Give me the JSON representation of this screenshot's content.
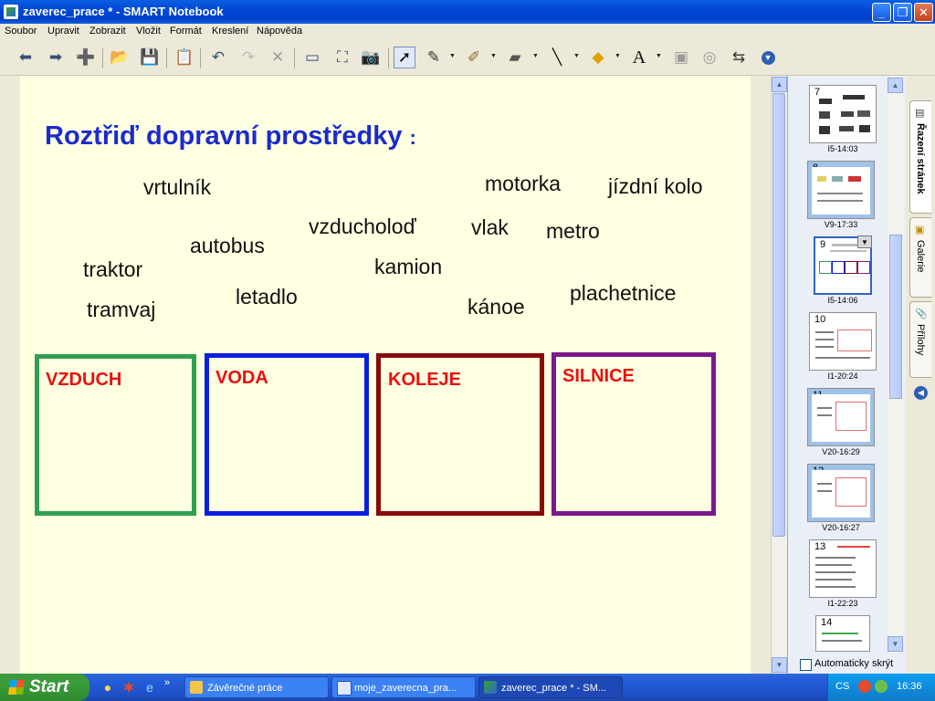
{
  "window": {
    "title": "zaverec_prace * - SMART Notebook"
  },
  "menu": [
    "Soubor",
    "Upravit",
    "Zobrazit",
    "Vložit",
    "Formát",
    "Kreslení",
    "Nápověda"
  ],
  "page": {
    "title": "Roztřiď  dopravní  prostředky",
    "title_colon": ":",
    "words": [
      "vrtulník",
      "motorka",
      "jízdní kolo",
      "vzducholoď",
      "vlak",
      "metro",
      "autobus",
      "traktor",
      "kamion",
      "letadlo",
      "plachetnice",
      "tramvaj",
      "kánoe"
    ],
    "categories": [
      {
        "label": "VZDUCH",
        "color": "#2fa04f"
      },
      {
        "label": "VODA",
        "color": "#0a1ee0"
      },
      {
        "label": "KOLEJE",
        "color": "#8a0a0a"
      },
      {
        "label": "SILNICE",
        "color": "#7a1a8a"
      }
    ]
  },
  "sorter": {
    "pages": [
      {
        "num": "7",
        "caption": "I5-14:03"
      },
      {
        "num": "8",
        "caption": "V9-17:33"
      },
      {
        "num": "9",
        "caption": "I5-14:06"
      },
      {
        "num": "10",
        "caption": "I1-20:24"
      },
      {
        "num": "11",
        "caption": "V20-16:29"
      },
      {
        "num": "12",
        "caption": "V20-16:27"
      },
      {
        "num": "13",
        "caption": "I1-22:23"
      },
      {
        "num": "14",
        "caption": ""
      }
    ],
    "auto_hide": "Automaticky skrýt"
  },
  "tabs": [
    "Řazení stránek",
    "Galerie",
    "Přílohy"
  ],
  "taskbar": {
    "start": "Start",
    "quicklaunch_more": "»",
    "tasks": [
      "Závěrečné práce",
      "moje_zaverecna_pra...",
      "zaverec_prace * - SM..."
    ],
    "lang": "CS",
    "clock": "16:36"
  }
}
